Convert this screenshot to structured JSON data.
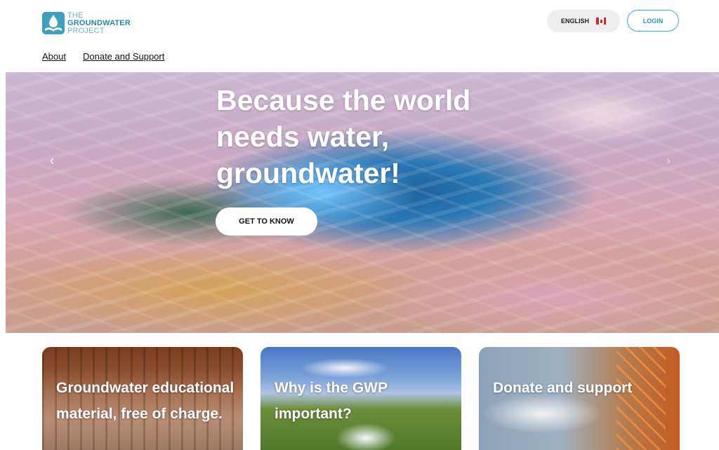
{
  "logo": {
    "line1": "THE",
    "line2": "GROUNDWATER",
    "line3": "PROJECT"
  },
  "nav": {
    "items": [
      {
        "label": "About"
      },
      {
        "label": "Donate and Support"
      }
    ]
  },
  "header": {
    "language_label": "ENGLISH",
    "login_label": "LOGIN"
  },
  "hero": {
    "title": "Because the world needs water, groundwater!",
    "cta_label": "GET TO KNOW",
    "prev_arrow": "‹",
    "next_arrow": "›"
  },
  "cards": [
    {
      "title": "Groundwater educational material, free of charge."
    },
    {
      "title": "Why is the GWP important?"
    },
    {
      "title": "Donate and support"
    }
  ],
  "colors": {
    "brand": "#3aa7c9",
    "brand_dark": "#2a86a8",
    "flag_red": "#e0242b"
  },
  "icons": {
    "logo": "droplet-book-icon",
    "flag": "canada-flag-icon",
    "prev": "chevron-left-icon",
    "next": "chevron-right-icon"
  }
}
